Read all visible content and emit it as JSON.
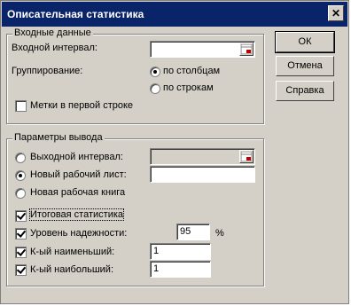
{
  "window": {
    "title": "Описательная статистика",
    "close_glyph": "✕"
  },
  "input_group": {
    "title": "Входные данные",
    "input_range_label": "Входной интервал:",
    "input_range_value": "",
    "grouping_label": "Группирование:",
    "by_columns_label": "по столбцам",
    "by_rows_label": "по строкам",
    "labels_first_row_label": "Метки в первой строке"
  },
  "output_group": {
    "title": "Параметры вывода",
    "output_range_label": "Выходной интервал:",
    "output_range_value": "",
    "new_sheet_label": "Новый рабочий лист:",
    "new_sheet_value": "",
    "new_workbook_label": "Новая рабочая книга",
    "summary_stats_label": "Итоговая статистика",
    "confidence_label": "Уровень надежности:",
    "confidence_value": "95",
    "percent_sign": "%",
    "kth_smallest_label": "К-ый наименьший:",
    "kth_smallest_value": "1",
    "kth_largest_label": "К-ый наибольший:",
    "kth_largest_value": "1"
  },
  "buttons": {
    "ok": "ОК",
    "cancel": "Отмена",
    "help": "Справка"
  }
}
